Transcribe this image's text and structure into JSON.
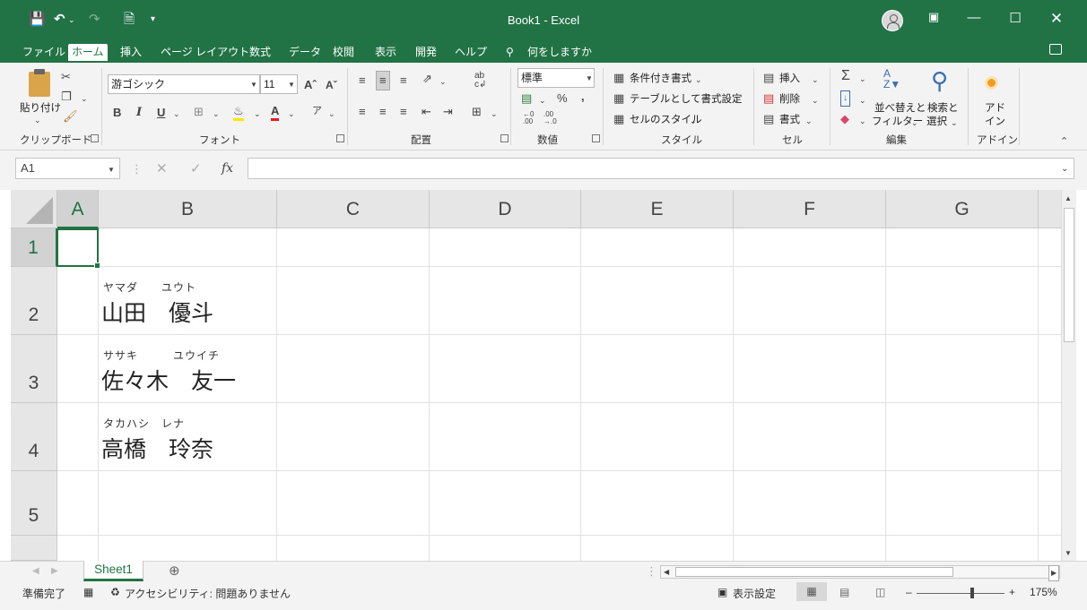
{
  "title": {
    "text": "Book1  -  Excel"
  },
  "menu": {
    "items": [
      "ファイル",
      "ホーム",
      "挿入",
      "ページ レイアウト",
      "数式",
      "データ",
      "校閲",
      "表示",
      "開発",
      "ヘルプ"
    ],
    "search": "何をしますか"
  },
  "ribbon": {
    "clipboard": {
      "paste": "貼り付け",
      "label": "クリップボード"
    },
    "font": {
      "name": "游ゴシック",
      "size": "11",
      "bold": "B",
      "italic": "I",
      "underline": "U",
      "label": "フォント"
    },
    "alignment": {
      "label": "配置"
    },
    "number": {
      "format": "標準",
      "label": "数値"
    },
    "styles": {
      "conditional": "条件付き書式",
      "table": "テーブルとして書式設定",
      "cell": "セルのスタイル",
      "label": "スタイル"
    },
    "cells": {
      "insert": "挿入",
      "delete": "削除",
      "format": "書式",
      "label": "セル"
    },
    "editing": {
      "sort": "並べ替えと",
      "filter": "フィルター",
      "find": "検索と",
      "select": "選択",
      "label": "編集"
    },
    "addins": {
      "top": "アド",
      "bottom": "イン",
      "label": "アドイン"
    }
  },
  "formula_bar": {
    "name_box": "A1",
    "fx": "fx"
  },
  "columns": [
    "A",
    "B",
    "C",
    "D",
    "E",
    "F",
    "G"
  ],
  "rows": [
    "1",
    "2",
    "3",
    "4",
    "5"
  ],
  "cells": [
    {
      "furigana": "ヤマダ　　ユウト",
      "name": "山田　優斗"
    },
    {
      "furigana": "ササキ　　　ユウイチ",
      "name": "佐々木　友一"
    },
    {
      "furigana": "タカハシ　レナ",
      "name": "高橋　玲奈"
    }
  ],
  "sheets": {
    "active": "Sheet1"
  },
  "status": {
    "ready": "準備完了",
    "accessibility": "アクセシビリティ: 問題ありません",
    "display_settings": "表示設定",
    "zoom": "175%"
  }
}
